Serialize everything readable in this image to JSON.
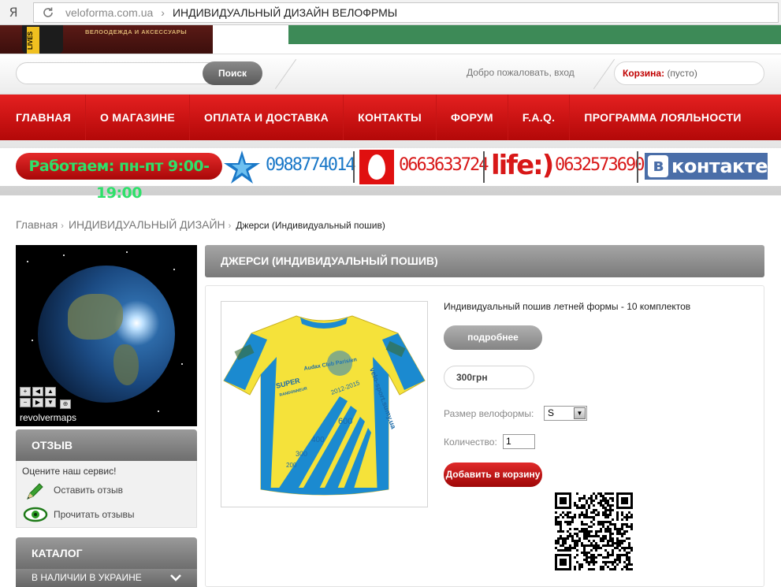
{
  "browser": {
    "favicon_letter": "Я",
    "domain": "veloforma.com.ua",
    "separator": "›",
    "page_title": "ИНДИВИДУАЛЬНЫЙ ДИЗАЙН ВЕЛОФРМЫ"
  },
  "banner": {
    "lives_text": "LIVES",
    "tagline": "ВЕЛООДЕЖДА И АКСЕССУАРЫ"
  },
  "header": {
    "search_button": "Поиск",
    "welcome": "Добро пожаловать, вход",
    "cart_label": "Корзина:",
    "cart_value": "(пусто)"
  },
  "nav": {
    "items": [
      "ГЛАВНАЯ",
      "О МАГАЗИНЕ",
      "ОПЛАТА И ДОСТАВКА",
      "КОНТАКТЫ",
      "ФОРУМ",
      "F.A.Q.",
      "ПРОГРАММА ЛОЯЛЬНОСТИ"
    ]
  },
  "phones": {
    "hours": "Работаем: пн-пт 9:00-19:00",
    "kyivstar": "0988774014",
    "mts": "0663633724",
    "life_logo": "life:)",
    "life": "0632573690",
    "vk_letter": "в",
    "vk_text": "контакте"
  },
  "breadcrumb": {
    "home": "Главная",
    "sep": "›",
    "category": "ИНДИВИДУАЛЬНЫЙ ДИЗАЙН",
    "current": "Джерси (Индивидуальный пошив)"
  },
  "sidebar": {
    "globe_label": "revolvermaps",
    "feedback_title": "ОТЗЫВ",
    "feedback_prompt": "Оцените наш сервис!",
    "leave_review": "Оставить отзыв",
    "read_reviews": "Прочитать отзывы",
    "catalog_title": "КАТАЛОГ",
    "catalog_first": "В НАЛИЧИИ В УКРАИНЕ"
  },
  "product": {
    "title": "ДЖЕРСИ (ИНДИВИДУАЛЬНЫЙ ПОШИВ)",
    "description": "Индивидуальный пошив летней формы - 10 комплектов",
    "more_button": "подробнее",
    "price": "300грн",
    "size_label": "Размер велоформы:",
    "size_value": "S",
    "qty_label": "Количество:",
    "qty_value": "1",
    "add_to_cart": "Добавить в корзину",
    "jersey_texts": [
      "SUPER",
      "RANDONNEUR",
      "2012-2015",
      "velo-sport.sumy.ua",
      "600",
      "400",
      "300",
      "200",
      "Audax Club Parisien"
    ]
  },
  "colors": {
    "nav_red": "#d41010",
    "phone_blue": "#1a78c8",
    "phone_red": "#d81818",
    "hours_green": "#2ee06a",
    "vk_blue": "#4a6ea8",
    "jersey_yellow": "#f5e23a",
    "jersey_blue": "#1b8ad0"
  }
}
